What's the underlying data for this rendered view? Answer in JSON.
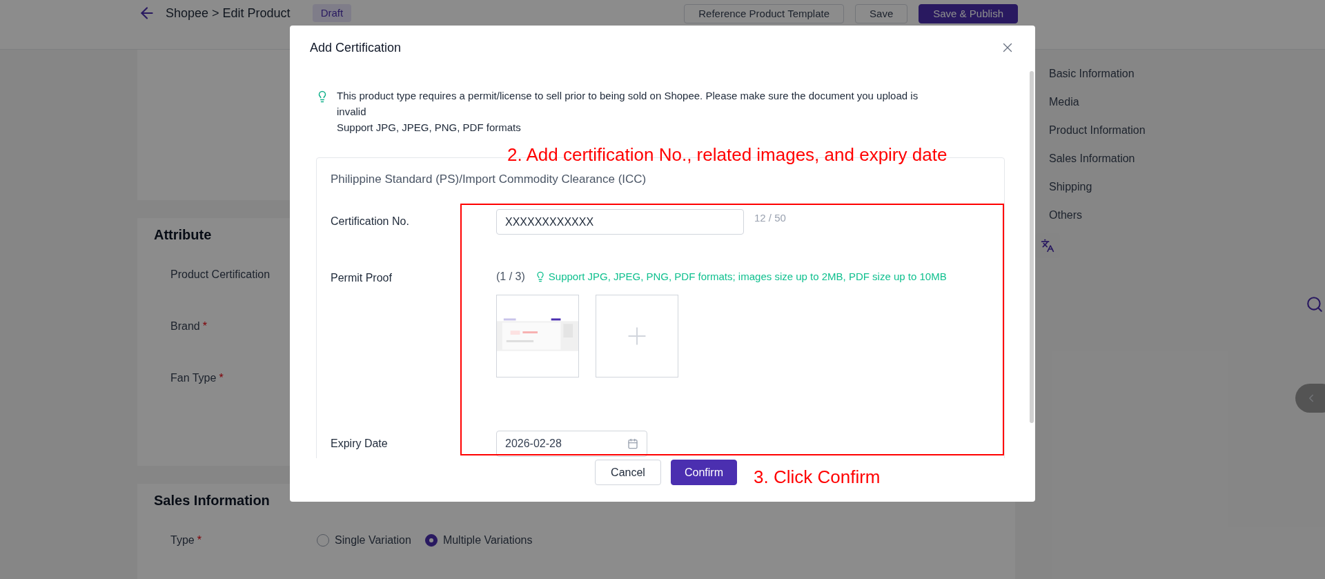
{
  "header": {
    "breadcrumb": "Shopee > Edit Product",
    "status": "Draft",
    "buttons": [
      {
        "label": "Reference Product Template",
        "kind": "outline"
      },
      {
        "label": "Save",
        "kind": "outline"
      },
      {
        "label": "Save & Publish",
        "kind": "primary"
      }
    ]
  },
  "sections": [
    {
      "title": "Attribute",
      "fields": [
        {
          "label": "Product Certification"
        },
        {
          "label": "Brand",
          "required_mark": "*"
        },
        {
          "label": "Fan Type",
          "required_mark": "*"
        }
      ]
    },
    {
      "title": "Sales Information",
      "fields": [
        {
          "label": "Type",
          "required_mark": "*",
          "options": [
            {
              "label": "Single Variation",
              "selected": false
            },
            {
              "label": "Multiple Variations",
              "selected": true
            }
          ]
        }
      ]
    }
  ],
  "side_nav": [
    "Basic Information",
    "Media",
    "Product Information",
    "Sales Information",
    "Shipping",
    "Others"
  ],
  "modal": {
    "title": "Add Certification",
    "notice": [
      "This product type requires a permit/license to sell prior to being sold on Shopee. Please make sure the document you upload is invalid",
      "Support JPG, JPEG, PNG, PDF formats"
    ],
    "certification": {
      "title": "Philippine Standard (PS)/Import Commodity Clearance (ICC)",
      "number": {
        "label": "Certification No.",
        "value": "XXXXXXXXXXXX",
        "counter": "12 / 50"
      },
      "permit_proof": {
        "label": "Permit Proof",
        "count": "(1 / 3)",
        "tip": "Support JPG, JPEG, PNG, PDF formats; images size up to 2MB, PDF size up to 10MB",
        "files": [
          {
            "kind": "picture"
          },
          {
            "kind": "add"
          }
        ]
      },
      "expiry": {
        "label": "Expiry Date",
        "value": "2026-02-28"
      }
    },
    "buttons": [
      {
        "label": "Cancel",
        "kind": "secondary"
      },
      {
        "label": "Confirm",
        "kind": "primary"
      }
    ],
    "annotations": [
      {
        "kind": "step_top",
        "text": "2. Add certification No., related images, and expiry date"
      },
      {
        "kind": "step_confirm",
        "text": "3. Click Confirm"
      }
    ]
  }
}
